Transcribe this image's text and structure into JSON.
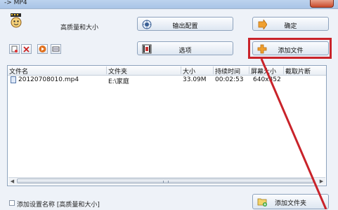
{
  "window": {
    "title": "-> MP4"
  },
  "header": {
    "quality_label": "高质量和大小"
  },
  "buttons": {
    "output_config": "输出配置",
    "confirm": "确定",
    "options": "选项",
    "add_file": "添加文件",
    "add_folder": "添加文件夹"
  },
  "table": {
    "columns": [
      "文件名",
      "文件夹",
      "大小",
      "持续时间",
      "屏幕大小",
      "截取片断"
    ],
    "rows": [
      {
        "filename": "20120708010.mp4",
        "folder": "E:\\家庭",
        "size": "33.09M",
        "duration": "00:02:53",
        "screen": "640x352",
        "clip": ""
      }
    ]
  },
  "footer": {
    "save_setting_label": "添加设置名称 [高质量和大小]"
  },
  "colors": {
    "highlight": "#c9232a",
    "arrow": "#c9232a"
  }
}
